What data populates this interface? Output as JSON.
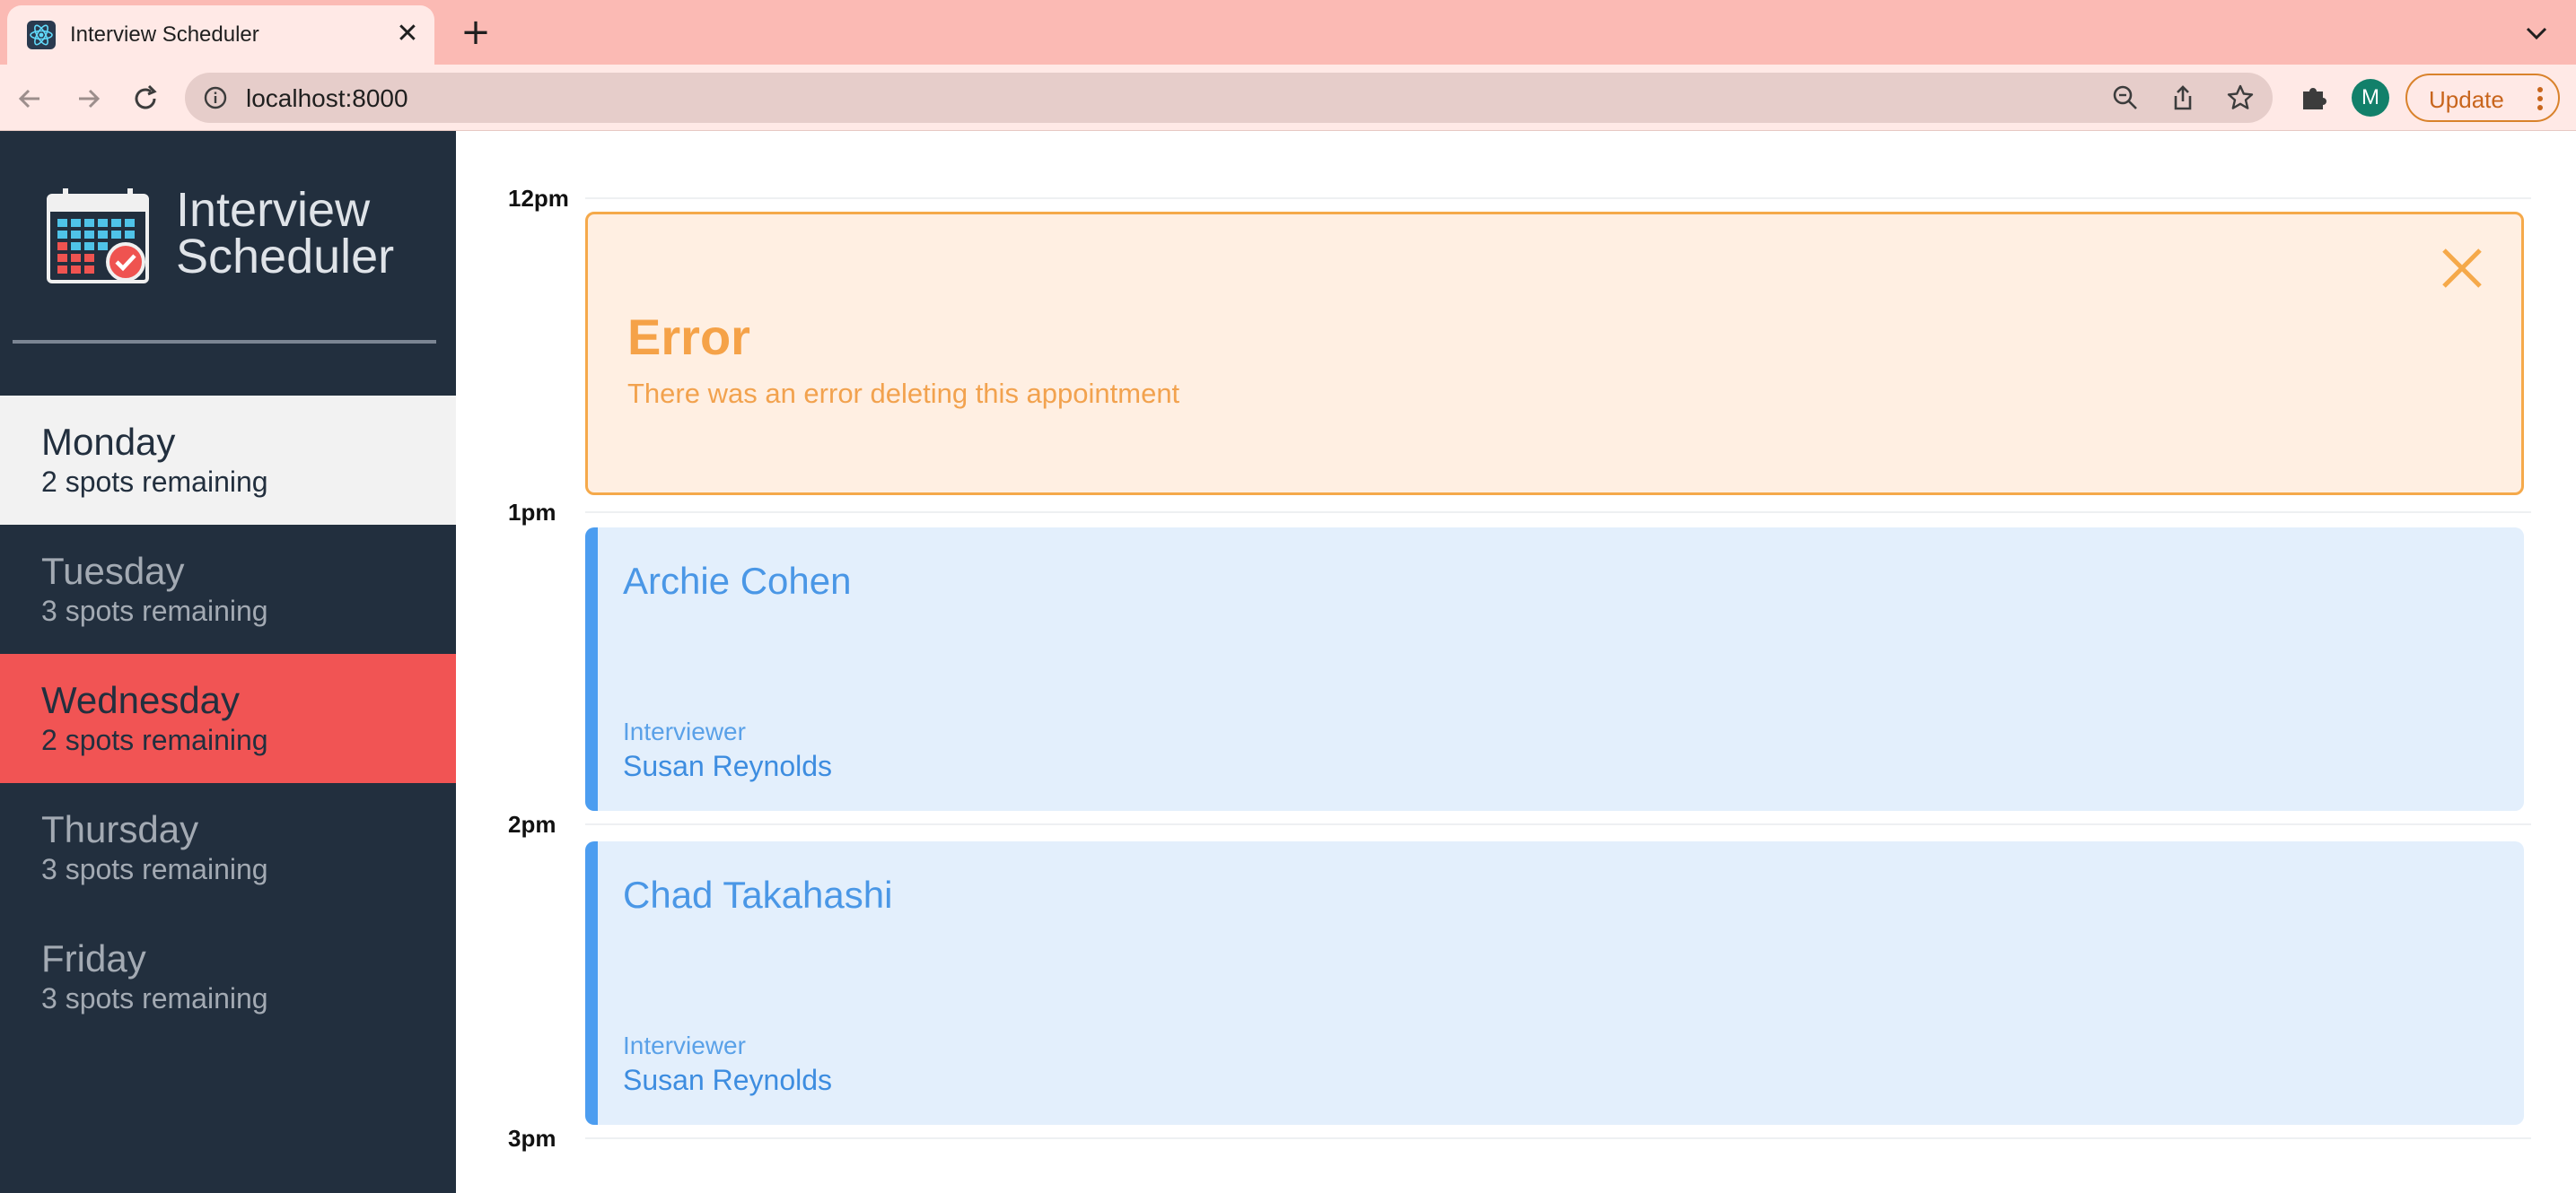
{
  "browser": {
    "tab_title": "Interview Scheduler",
    "tab_close": "✕",
    "new_tab": "+",
    "url": "localhost:8000",
    "avatar_initial": "M",
    "update_label": "Update"
  },
  "app": {
    "logo_line1": "Interview",
    "logo_line2": "Scheduler"
  },
  "days": [
    {
      "name": "Monday",
      "spots": "2 spots remaining",
      "state": "hover"
    },
    {
      "name": "Tuesday",
      "spots": "3 spots remaining",
      "state": "normal"
    },
    {
      "name": "Wednesday",
      "spots": "2 spots remaining",
      "state": "selected"
    },
    {
      "name": "Thursday",
      "spots": "3 spots remaining",
      "state": "normal"
    },
    {
      "name": "Friday",
      "spots": "3 spots remaining",
      "state": "normal"
    }
  ],
  "schedule": {
    "times": [
      "12pm",
      "1pm",
      "2pm",
      "3pm"
    ],
    "error": {
      "title": "Error",
      "message": "There was an error deleting this appointment"
    },
    "appointments": [
      {
        "student": "Archie Cohen",
        "interviewer_label": "Interviewer",
        "interviewer": "Susan Reynolds"
      },
      {
        "student": "Chad Takahashi",
        "interviewer_label": "Interviewer",
        "interviewer": "Susan Reynolds"
      }
    ]
  },
  "colors": {
    "sidebar_bg": "#222f3e",
    "selected_day": "#f15454",
    "hover_day": "#f2f2f2",
    "error_accent": "#f5a94a",
    "appointment_accent": "#4c9df0"
  }
}
